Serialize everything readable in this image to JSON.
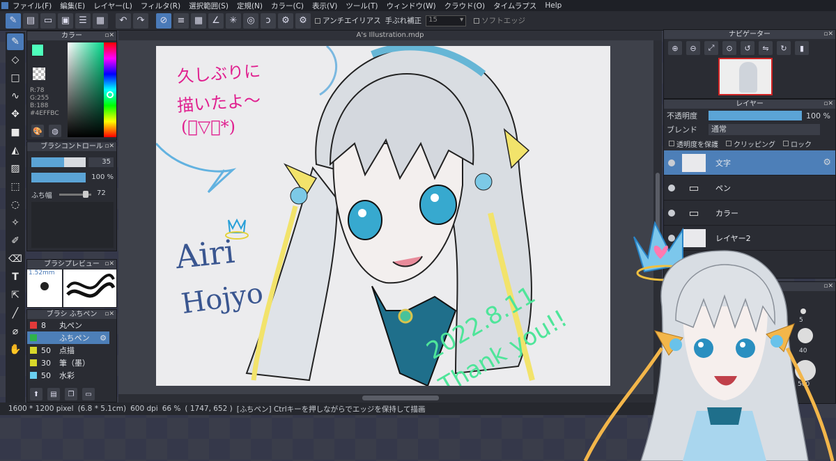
{
  "menu": [
    "ファイル(F)",
    "編集(E)",
    "レイヤー(L)",
    "フィルタ(R)",
    "選択範囲(S)",
    "定規(N)",
    "カラー(C)",
    "表示(V)",
    "ツール(T)",
    "ウィンドウ(W)",
    "クラウド(O)",
    "タイムラプス",
    "Help"
  ],
  "toolbar": {
    "antialias_label": "アンチエイリアス",
    "stabilizer_label": "手ぶれ補正",
    "stabilizer_value": "15",
    "soft_edge_label": "ソフトエッジ"
  },
  "color_panel": {
    "title": "カラー",
    "r": "R:78",
    "g": "G:255",
    "b": "B:188",
    "hex": "#4EFFBC",
    "fg_color": "#4EFFBC"
  },
  "brush_control": {
    "title": "ブラシコントロール",
    "size_value": "35",
    "opacity_value": "100 %",
    "edge_label": "ふち幅",
    "edge_value": "72"
  },
  "brush_preview": {
    "title": "ブラシプレビュー",
    "size": "1.52mm"
  },
  "brush_list": {
    "title": "ブラシ ふちペン",
    "items": [
      {
        "size": "8",
        "name": "丸ペン",
        "color": "#e23a3a"
      },
      {
        "size": "",
        "name": "ふちペン",
        "color": "#2fb34a"
      },
      {
        "size": "50",
        "name": "点描",
        "color": "#d8d82a"
      },
      {
        "size": "30",
        "name": "筆（墨）",
        "color": "#d8d82a"
      },
      {
        "size": "50",
        "name": "水彩",
        "color": "#6ad0f0"
      }
    ]
  },
  "document": {
    "tab_title": "A's Illustration.mdp"
  },
  "status": {
    "size": "1600 * 1200 pixel",
    "cm": "(6.8 * 5.1cm)",
    "dpi": "600 dpi",
    "zoom": "66 %",
    "coords": "( 1747, 652 )",
    "tip": "[ふちペン] Ctrlキーを押しながらでエッジを保持して描画"
  },
  "navigator": {
    "title": "ナビゲーター"
  },
  "layer_panel": {
    "title": "レイヤー",
    "opacity_label": "不透明度",
    "opacity_value": "100 %",
    "opacity_level": 1.0,
    "blend_label": "ブレンド",
    "blend_value": "通常",
    "protect_label": "透明度を保護",
    "clip_label": "クリッピング",
    "lock_label": "ロック",
    "layers": [
      {
        "name": "文字",
        "type": "layer"
      },
      {
        "name": "ペン",
        "type": "folder"
      },
      {
        "name": "カラー",
        "type": "folder"
      },
      {
        "name": "レイヤー2",
        "type": "layer"
      }
    ]
  },
  "side_brush_sizes": [
    "5",
    "40",
    "500"
  ],
  "canvas_text": {
    "line1": "久しぶりに",
    "line2": "描いたよ〜",
    "line3": "(ﾟ▽ﾟ*)",
    "sig1": "Airi",
    "sig2": "Hojyo",
    "date": "2022.8.11",
    "thanks": "Thank you!!"
  }
}
